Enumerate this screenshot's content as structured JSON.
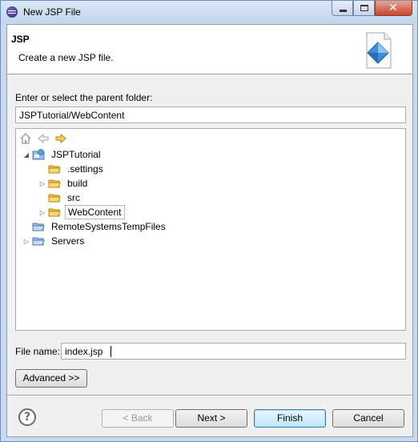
{
  "window": {
    "title": "New JSP File"
  },
  "header": {
    "title": "JSP",
    "description": "Create a new JSP file."
  },
  "parent_folder": {
    "label": "Enter or select the parent folder:",
    "value": "JSPTutorial/WebContent"
  },
  "tree_toolbar": {
    "icons": [
      "home-icon",
      "back-icon",
      "forward-icon"
    ]
  },
  "tree": {
    "items": [
      {
        "label": "JSPTutorial",
        "icon": "project-icon",
        "expanded": true
      },
      {
        "label": ".settings",
        "icon": "folder-icon"
      },
      {
        "label": "build",
        "icon": "folder-icon",
        "collapsed": true
      },
      {
        "label": "src",
        "icon": "folder-icon"
      },
      {
        "label": "WebContent",
        "icon": "folder-icon",
        "collapsed": true,
        "selected": true
      },
      {
        "label": "RemoteSystemsTempFiles",
        "icon": "project-folder-icon"
      },
      {
        "label": "Servers",
        "icon": "project-folder-icon",
        "collapsed": true
      }
    ]
  },
  "file_name": {
    "label": "File name:",
    "value": "index.jsp"
  },
  "buttons": {
    "advanced": "Advanced >>",
    "back": "< Back",
    "next": "Next >",
    "finish": "Finish",
    "cancel": "Cancel"
  },
  "colors": {
    "title_bar": "#c9daee",
    "dialog_bg": "#f0f0f0",
    "default_button": "#bee6fd",
    "folder": "#f5c04a",
    "close_button": "#c6472e"
  }
}
